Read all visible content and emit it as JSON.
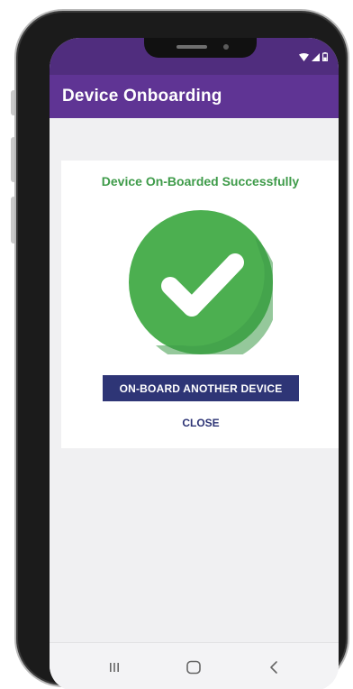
{
  "app": {
    "title": "Device Onboarding"
  },
  "status_bar": {
    "icons": [
      "wifi-icon",
      "cellular-signal-icon",
      "battery-icon"
    ]
  },
  "result_card": {
    "title": "Device On-Boarded Successfully",
    "icon": "check-circle-icon",
    "primary_button_label": "ON-BOARD ANOTHER DEVICE",
    "secondary_button_label": "CLOSE"
  },
  "navigation_bar": {
    "items": [
      "recent-apps-icon",
      "home-icon",
      "back-icon"
    ]
  },
  "colors": {
    "status_bar": "#502d7e",
    "app_bar": "#5f3494",
    "success_green": "#3e9b49",
    "check_circle": "#4caf50",
    "primary_button": "#2e3576",
    "screen_background": "#f0f0f2"
  }
}
